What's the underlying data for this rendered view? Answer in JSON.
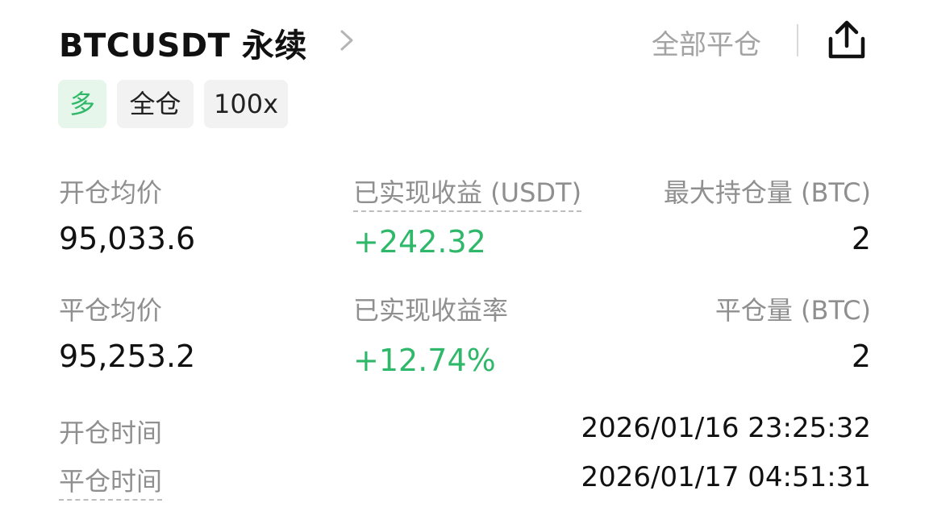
{
  "header": {
    "title": "BTCUSDT 永续",
    "close_all_label": "全部平仓",
    "chevron_icon": "chevron-right-icon",
    "share_icon": "share-icon"
  },
  "tags": {
    "side": "多",
    "margin_mode": "全仓",
    "leverage": "100x"
  },
  "colors": {
    "profit_green": "#2fb86a",
    "label_gray": "#8f8f8f",
    "tag_bg": "#f2f2f2",
    "long_tag_bg": "#e6f6eb"
  },
  "stats": {
    "open_avg_price_label": "开仓均价",
    "open_avg_price": "95,033.6",
    "realized_pnl_label": "已实现收益 (USDT)",
    "realized_pnl": "+242.32",
    "max_position_label": "最大持仓量 (BTC)",
    "max_position": "2",
    "close_avg_price_label": "平仓均价",
    "close_avg_price": "95,253.2",
    "realized_pnl_rate_label": "已实现收益率",
    "realized_pnl_rate": "+12.74%",
    "close_qty_label": "平仓量 (BTC)",
    "close_qty": "2"
  },
  "times": {
    "open_time_label": "开仓时间",
    "open_time": "2026/01/16 23:25:32",
    "close_time_label": "平仓时间",
    "close_time": "2026/01/17 04:51:31"
  }
}
